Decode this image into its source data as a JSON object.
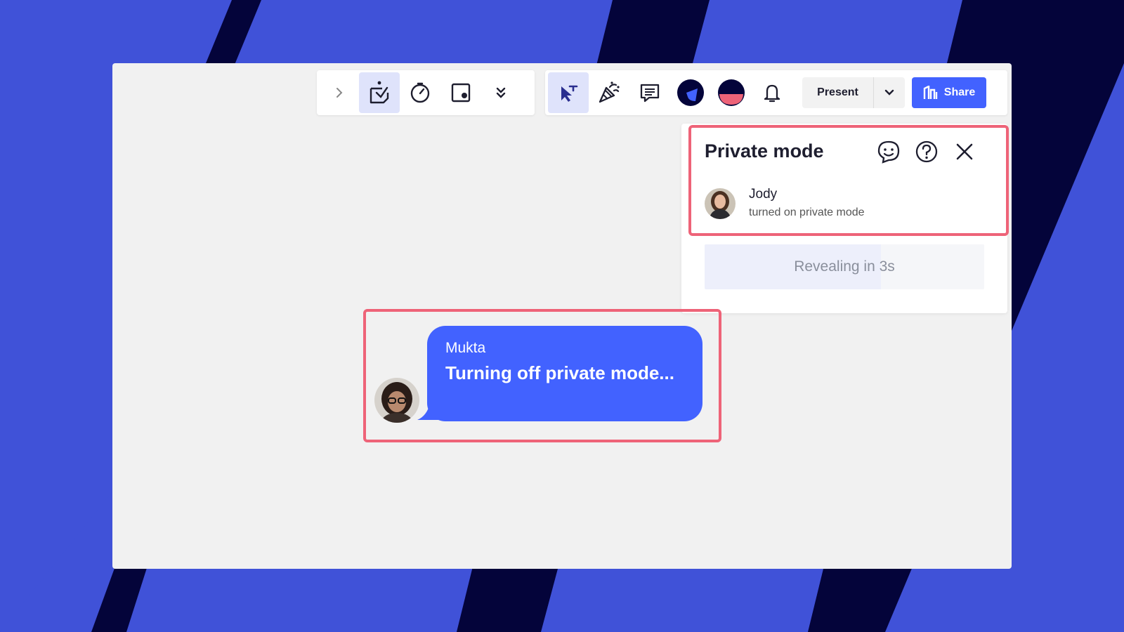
{
  "toolbar": {
    "expand_icon": "chevron-right-icon",
    "left_tools": [
      {
        "name": "sticky-notes-icon",
        "active": true
      },
      {
        "name": "timer-icon",
        "active": false
      },
      {
        "name": "frame-icon",
        "active": false
      },
      {
        "name": "double-chevron-down-icon",
        "active": false
      }
    ],
    "right_tools": [
      {
        "name": "private-mode-icon",
        "active": true
      },
      {
        "name": "celebrate-icon",
        "active": false
      },
      {
        "name": "comments-icon",
        "active": false
      },
      {
        "name": "user-avatar-icon",
        "active": false
      },
      {
        "name": "user-avatar-icon",
        "active": false
      },
      {
        "name": "bell-icon",
        "active": false
      }
    ],
    "present_label": "Present",
    "share_label": "Share"
  },
  "private_mode_panel": {
    "title": "Private mode",
    "icons": [
      "feedback-smiley-icon",
      "help-icon",
      "close-icon"
    ],
    "user_name": "Jody",
    "user_status": "turned on private mode",
    "reveal_label": "Revealing in 3s",
    "reveal_progress": 0.63
  },
  "chat_message": {
    "sender": "Mukta",
    "text": "Turning off private mode..."
  },
  "colors": {
    "accent": "#4262ff",
    "highlight": "#ee6378",
    "background_blue": "#4052d8",
    "background_navy": "#04043a"
  }
}
